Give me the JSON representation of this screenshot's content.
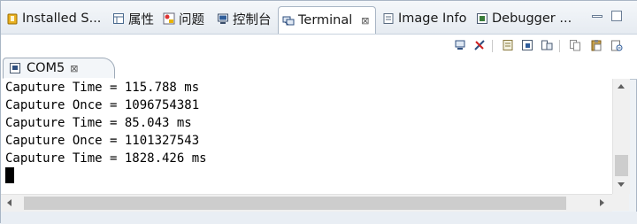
{
  "view_tabs": [
    {
      "label": "Installed S...",
      "icon": "installed-software-icon"
    },
    {
      "label": "属性",
      "icon": "properties-icon"
    },
    {
      "label": "问题",
      "icon": "problems-icon"
    },
    {
      "label": "控制台",
      "icon": "console-icon"
    },
    {
      "label": "Terminal",
      "icon": "terminal-icon",
      "active": true,
      "close": "⊠"
    },
    {
      "label": "Image Info",
      "icon": "image-info-icon"
    },
    {
      "label": "Debugger ...",
      "icon": "debugger-icon"
    }
  ],
  "console_tab": {
    "label": "COM5",
    "close": "⊠"
  },
  "terminal_lines": [
    "Caputure Time = 115.788 ms",
    "Caputure Once = 1096754381",
    "Caputure Time = 85.043 ms",
    "Caputure Once = 1101327543",
    "Caputure Time = 1828.426 ms"
  ]
}
